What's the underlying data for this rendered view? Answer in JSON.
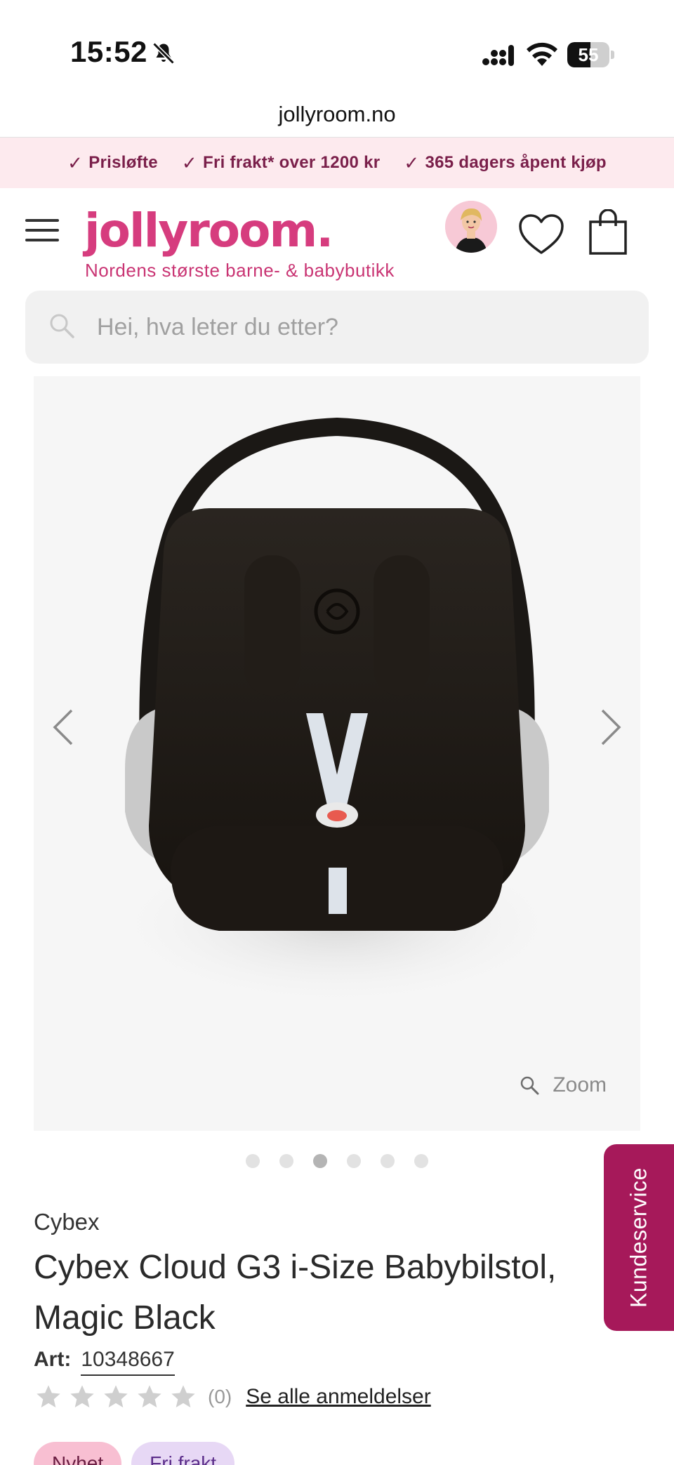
{
  "status_bar": {
    "time": "15:52",
    "battery": "55",
    "battery_level": 0.55
  },
  "browser": {
    "url": "jollyroom.no"
  },
  "usp_bar": {
    "items": [
      "Prisløfte",
      "Fri frakt* over 1200 kr",
      "365 dagers åpent kjøp"
    ]
  },
  "header": {
    "logo": "jollyroom.",
    "tagline": "Nordens største barne- & babybutikk"
  },
  "search": {
    "placeholder": "Hei, hva leter du etter?"
  },
  "gallery": {
    "zoom_label": "Zoom",
    "dot_count": 6,
    "active_index": 2
  },
  "customer_service": {
    "label": "Kundeservice"
  },
  "product": {
    "brand": "Cybex",
    "title": "Cybex Cloud G3 i-Size Babybilstol, Magic Black",
    "art_label": "Art:",
    "art_number": "10348667",
    "rating_value": 0,
    "rating_max": 5,
    "rating_count": "(0)",
    "reviews_link": "Se alle anmeldelser"
  },
  "badges": {
    "new": "Nyhet",
    "shipping": "Fri frakt"
  },
  "colors": {
    "brand_pink": "#d63c7e",
    "usp_bg": "#fdeaee",
    "cs_tab": "#a6195a"
  }
}
